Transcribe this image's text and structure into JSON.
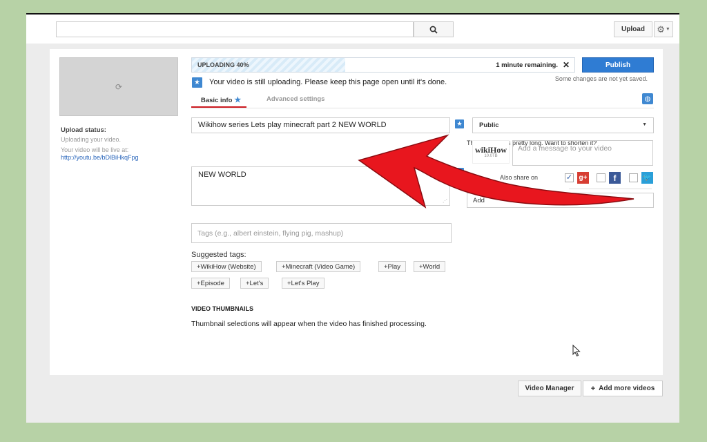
{
  "header": {
    "search_placeholder": "",
    "upload_label": "Upload"
  },
  "upload_panel": {
    "status_label": "Upload status:",
    "status_text": "Uploading your video.",
    "live_text": "Your video will be live at:",
    "live_url": "http://youtu.be/bDlBiHkqFpg"
  },
  "progress": {
    "label": "UPLOADING 40%",
    "percent": 40,
    "remaining": "1 minute remaining.",
    "close_glyph": "✕"
  },
  "publish": {
    "label": "Publish",
    "unsaved_note": "Some changes are not yet saved."
  },
  "notice": {
    "text": "Your video is still uploading. Please keep this page open until it's done."
  },
  "tabs": {
    "basic": "Basic info",
    "advanced": "Advanced settings"
  },
  "form": {
    "title": "Wikihow series Lets play minecraft part  2 NEW WORLD",
    "description": "NEW WORLD",
    "tags_placeholder": "Tags (e.g., albert einstein, flying pig, mashup)",
    "privacy": "Public"
  },
  "share": {
    "long_title_note": "That title seems pretty long. Want to shorten it?",
    "logo_text": "wikiHow",
    "logo_sub": "10.0TB",
    "message_placeholder": "Add a message to your video",
    "also_share": "Also share on",
    "category": "Add"
  },
  "suggested_tags": {
    "label": "Suggested tags:",
    "items": [
      "+WikiHow (Website)",
      "+Minecraft (Video Game)",
      "+Play",
      "+World",
      "+Episode",
      "+Let's",
      "+Let's Play"
    ]
  },
  "thumbnails": {
    "heading": "VIDEO THUMBNAILS",
    "text": "Thumbnail selections will appear when the video has finished processing."
  },
  "footer": {
    "video_manager": "Video Manager",
    "add_more": "Add more videos"
  },
  "colors": {
    "accent": "#2f7cd3",
    "tab_underline": "#cc181e",
    "arrow": "#e8161e",
    "background": "#b7d2a6"
  }
}
